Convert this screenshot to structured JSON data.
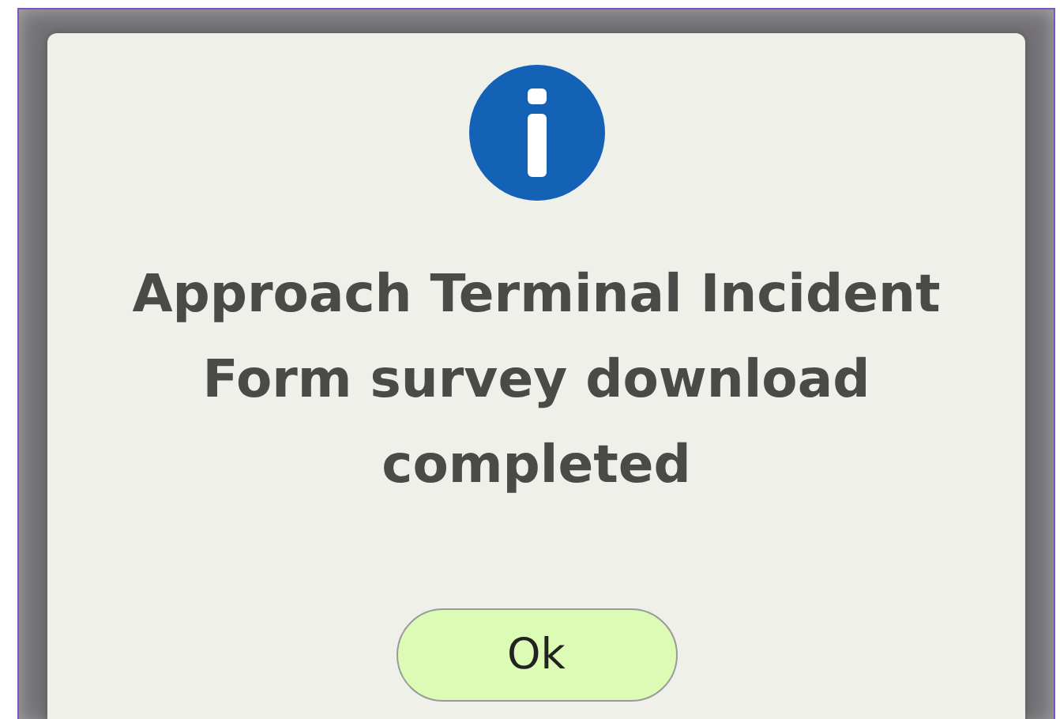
{
  "dialog": {
    "message": "Approach Terminal Incident Form survey download completed",
    "buttons": [
      "Ok"
    ]
  }
}
